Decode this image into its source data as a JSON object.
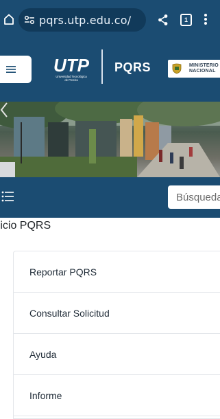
{
  "browser": {
    "url": "pqrs.utp.edu.co/",
    "tab_count": "1"
  },
  "header": {
    "logo_text": "UTP",
    "logo_subtext": "Universidad Tecnológica de Pereira",
    "title": "PQRS",
    "ministerio_line1": "MINISTERIO",
    "ministerio_line2": "NACIONAL"
  },
  "navbar": {
    "search_placeholder": "Búsqueda"
  },
  "breadcrumb": {
    "text": "Inicio PQRS"
  },
  "menu": {
    "items": [
      {
        "label": "Reportar PQRS"
      },
      {
        "label": "Consultar Solicitud"
      },
      {
        "label": "Ayuda"
      },
      {
        "label": "Informe"
      }
    ]
  },
  "colors": {
    "brand_blue": "#1b4c72",
    "url_pill": "#113a5a",
    "border": "#e3e6ea"
  }
}
